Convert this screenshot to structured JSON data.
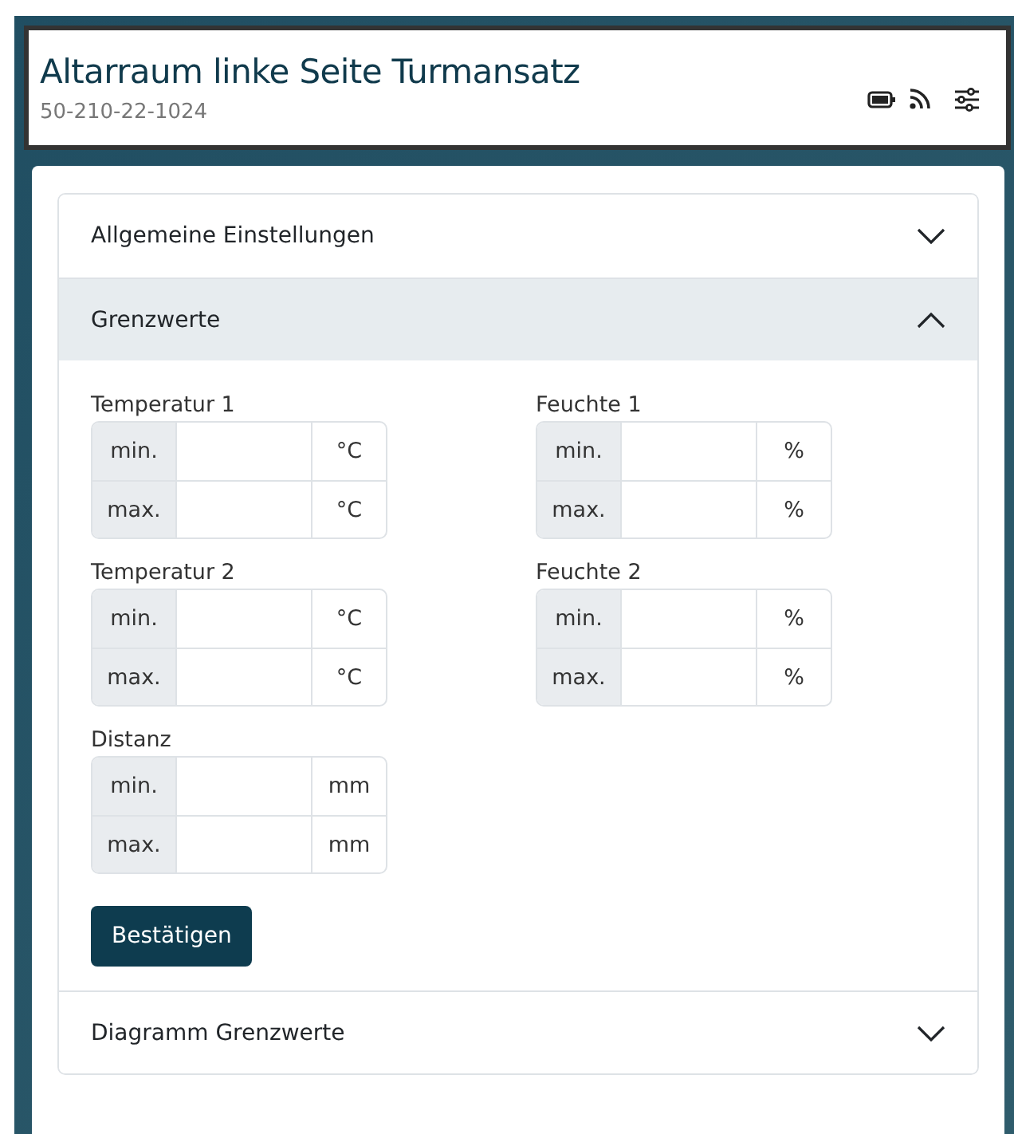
{
  "header": {
    "title": "Altarraum linke Seite Turmansatz",
    "subtitle": "50-210-22-1024"
  },
  "sections": [
    {
      "title": "Allgemeine Einstellungen",
      "expanded": false
    },
    {
      "title": "Grenzwerte",
      "expanded": true,
      "groups": [
        {
          "label": "Temperatur 1",
          "rows": [
            {
              "label": "min.",
              "unit": "°C"
            },
            {
              "label": "max.",
              "unit": "°C"
            }
          ]
        },
        {
          "label": "Feuchte 1",
          "rows": [
            {
              "label": "min.",
              "unit": "%"
            },
            {
              "label": "max.",
              "unit": "%"
            }
          ]
        },
        {
          "label": "Temperatur 2",
          "rows": [
            {
              "label": "min.",
              "unit": "°C"
            },
            {
              "label": "max.",
              "unit": "°C"
            }
          ]
        },
        {
          "label": "Feuchte 2",
          "rows": [
            {
              "label": "min.",
              "unit": "%"
            },
            {
              "label": "max.",
              "unit": "%"
            }
          ]
        },
        {
          "label": "Distanz",
          "rows": [
            {
              "label": "min.",
              "unit": "mm"
            },
            {
              "label": "max.",
              "unit": "mm"
            }
          ]
        }
      ],
      "button": "Bestätigen"
    },
    {
      "title": "Diagramm Grenzwerte",
      "expanded": false
    }
  ]
}
